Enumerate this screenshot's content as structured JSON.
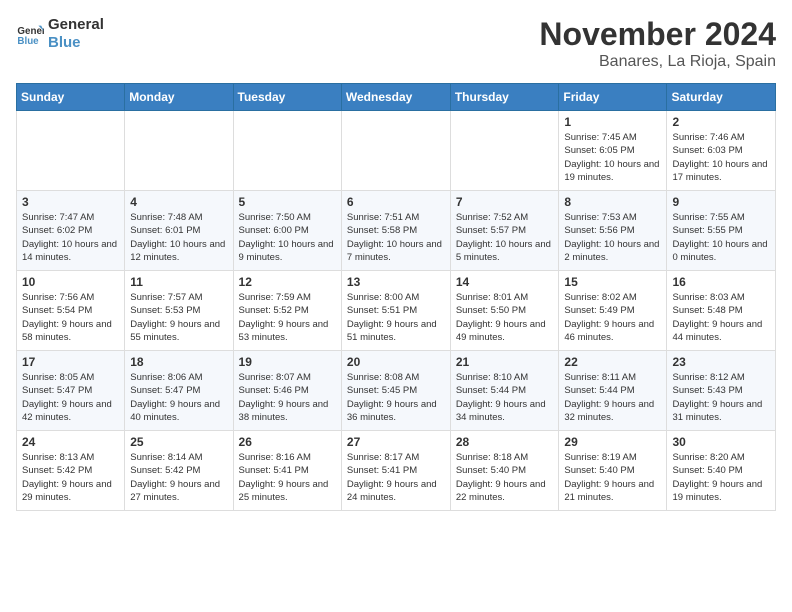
{
  "header": {
    "logo_line1": "General",
    "logo_line2": "Blue",
    "month_year": "November 2024",
    "location": "Banares, La Rioja, Spain"
  },
  "weekdays": [
    "Sunday",
    "Monday",
    "Tuesday",
    "Wednesday",
    "Thursday",
    "Friday",
    "Saturday"
  ],
  "weeks": [
    [
      {
        "day": "",
        "info": ""
      },
      {
        "day": "",
        "info": ""
      },
      {
        "day": "",
        "info": ""
      },
      {
        "day": "",
        "info": ""
      },
      {
        "day": "",
        "info": ""
      },
      {
        "day": "1",
        "info": "Sunrise: 7:45 AM\nSunset: 6:05 PM\nDaylight: 10 hours and 19 minutes."
      },
      {
        "day": "2",
        "info": "Sunrise: 7:46 AM\nSunset: 6:03 PM\nDaylight: 10 hours and 17 minutes."
      }
    ],
    [
      {
        "day": "3",
        "info": "Sunrise: 7:47 AM\nSunset: 6:02 PM\nDaylight: 10 hours and 14 minutes."
      },
      {
        "day": "4",
        "info": "Sunrise: 7:48 AM\nSunset: 6:01 PM\nDaylight: 10 hours and 12 minutes."
      },
      {
        "day": "5",
        "info": "Sunrise: 7:50 AM\nSunset: 6:00 PM\nDaylight: 10 hours and 9 minutes."
      },
      {
        "day": "6",
        "info": "Sunrise: 7:51 AM\nSunset: 5:58 PM\nDaylight: 10 hours and 7 minutes."
      },
      {
        "day": "7",
        "info": "Sunrise: 7:52 AM\nSunset: 5:57 PM\nDaylight: 10 hours and 5 minutes."
      },
      {
        "day": "8",
        "info": "Sunrise: 7:53 AM\nSunset: 5:56 PM\nDaylight: 10 hours and 2 minutes."
      },
      {
        "day": "9",
        "info": "Sunrise: 7:55 AM\nSunset: 5:55 PM\nDaylight: 10 hours and 0 minutes."
      }
    ],
    [
      {
        "day": "10",
        "info": "Sunrise: 7:56 AM\nSunset: 5:54 PM\nDaylight: 9 hours and 58 minutes."
      },
      {
        "day": "11",
        "info": "Sunrise: 7:57 AM\nSunset: 5:53 PM\nDaylight: 9 hours and 55 minutes."
      },
      {
        "day": "12",
        "info": "Sunrise: 7:59 AM\nSunset: 5:52 PM\nDaylight: 9 hours and 53 minutes."
      },
      {
        "day": "13",
        "info": "Sunrise: 8:00 AM\nSunset: 5:51 PM\nDaylight: 9 hours and 51 minutes."
      },
      {
        "day": "14",
        "info": "Sunrise: 8:01 AM\nSunset: 5:50 PM\nDaylight: 9 hours and 49 minutes."
      },
      {
        "day": "15",
        "info": "Sunrise: 8:02 AM\nSunset: 5:49 PM\nDaylight: 9 hours and 46 minutes."
      },
      {
        "day": "16",
        "info": "Sunrise: 8:03 AM\nSunset: 5:48 PM\nDaylight: 9 hours and 44 minutes."
      }
    ],
    [
      {
        "day": "17",
        "info": "Sunrise: 8:05 AM\nSunset: 5:47 PM\nDaylight: 9 hours and 42 minutes."
      },
      {
        "day": "18",
        "info": "Sunrise: 8:06 AM\nSunset: 5:47 PM\nDaylight: 9 hours and 40 minutes."
      },
      {
        "day": "19",
        "info": "Sunrise: 8:07 AM\nSunset: 5:46 PM\nDaylight: 9 hours and 38 minutes."
      },
      {
        "day": "20",
        "info": "Sunrise: 8:08 AM\nSunset: 5:45 PM\nDaylight: 9 hours and 36 minutes."
      },
      {
        "day": "21",
        "info": "Sunrise: 8:10 AM\nSunset: 5:44 PM\nDaylight: 9 hours and 34 minutes."
      },
      {
        "day": "22",
        "info": "Sunrise: 8:11 AM\nSunset: 5:44 PM\nDaylight: 9 hours and 32 minutes."
      },
      {
        "day": "23",
        "info": "Sunrise: 8:12 AM\nSunset: 5:43 PM\nDaylight: 9 hours and 31 minutes."
      }
    ],
    [
      {
        "day": "24",
        "info": "Sunrise: 8:13 AM\nSunset: 5:42 PM\nDaylight: 9 hours and 29 minutes."
      },
      {
        "day": "25",
        "info": "Sunrise: 8:14 AM\nSunset: 5:42 PM\nDaylight: 9 hours and 27 minutes."
      },
      {
        "day": "26",
        "info": "Sunrise: 8:16 AM\nSunset: 5:41 PM\nDaylight: 9 hours and 25 minutes."
      },
      {
        "day": "27",
        "info": "Sunrise: 8:17 AM\nSunset: 5:41 PM\nDaylight: 9 hours and 24 minutes."
      },
      {
        "day": "28",
        "info": "Sunrise: 8:18 AM\nSunset: 5:40 PM\nDaylight: 9 hours and 22 minutes."
      },
      {
        "day": "29",
        "info": "Sunrise: 8:19 AM\nSunset: 5:40 PM\nDaylight: 9 hours and 21 minutes."
      },
      {
        "day": "30",
        "info": "Sunrise: 8:20 AM\nSunset: 5:40 PM\nDaylight: 9 hours and 19 minutes."
      }
    ]
  ]
}
